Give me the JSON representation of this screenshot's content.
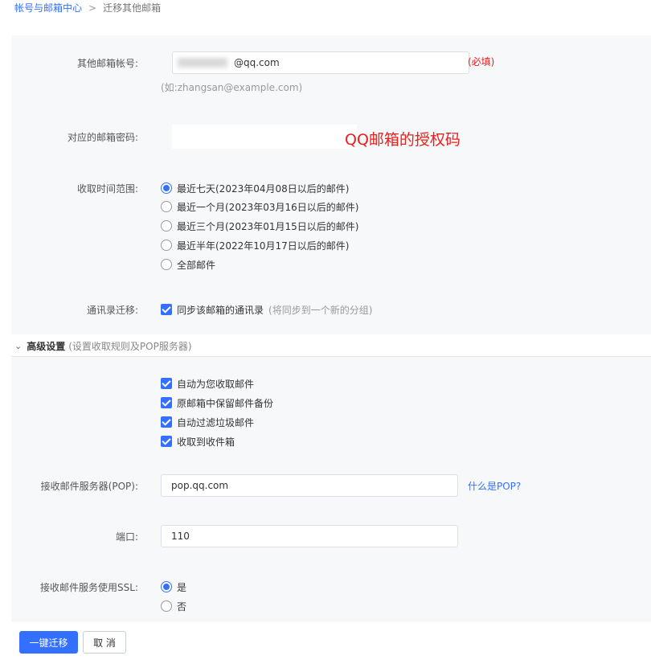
{
  "breadcrumb": {
    "parent": "帐号与邮箱中心",
    "separator": ">",
    "current": "迁移其他邮箱"
  },
  "account": {
    "label": "其他邮箱帐号:",
    "value_visible": "@qq.com",
    "required": "(必填)",
    "hint": "(如:zhangsan@example.com)"
  },
  "password": {
    "label": "对应的邮箱密码:",
    "annotation": "QQ邮箱的授权码"
  },
  "time_range": {
    "label": "收取时间范围:",
    "options": [
      "最近七天(2023年04月08日以后的邮件)",
      "最近一个月(2023年03月16日以后的邮件)",
      "最近三个月(2023年01月15日以后的邮件)",
      "最近半年(2022年10月17日以后的邮件)",
      "全部邮件"
    ],
    "selected_index": 0
  },
  "contacts": {
    "label": "通讯录迁移:",
    "checkbox_label": "同步该邮箱的通讯录",
    "checkbox_note": "(将同步到一个新的分组)",
    "checked": true
  },
  "advanced": {
    "title": "高级设置",
    "subtitle": "(设置收取规则及POP服务器)",
    "options": [
      "自动为您收取邮件",
      "原邮箱中保留邮件备份",
      "自动过滤垃圾邮件",
      "收取到收件箱"
    ],
    "pop_label": "接收邮件服务器(POP):",
    "pop_value": "pop.qq.com",
    "pop_help": "什么是POP?",
    "port_label": "端口:",
    "port_value": "110",
    "ssl_label": "接收邮件服务使用SSL:",
    "ssl_options": [
      "是",
      "否"
    ],
    "ssl_selected_index": 0
  },
  "buttons": {
    "migrate": "一键迁移",
    "cancel": "取 消"
  },
  "colors": {
    "accent": "#3370ff",
    "required": "#e02020",
    "annotation": "#e8201c",
    "panel_bg": "#f7f8fa"
  },
  "icons": {
    "section_toggle": "chevron-down-icon",
    "radio": "radio-icon",
    "checkbox": "checkbox-icon"
  }
}
